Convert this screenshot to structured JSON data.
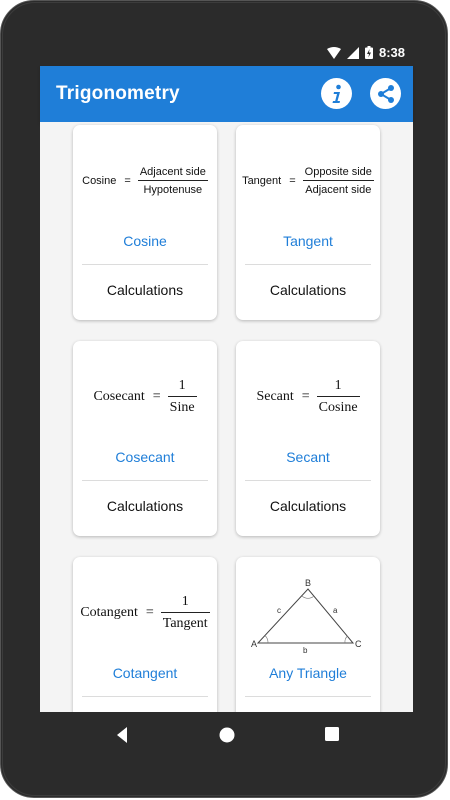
{
  "status": {
    "time": "8:38"
  },
  "appbar": {
    "title": "Trigonometry",
    "info_icon": "info-icon",
    "share_icon": "share-icon"
  },
  "cards": [
    {
      "formula_lhs": "Cosine",
      "formula_eq": "=",
      "formula_num": "Adjacent side",
      "formula_den": "Hypotenuse",
      "title": "Cosine",
      "action": "Calculations"
    },
    {
      "formula_lhs": "Tangent",
      "formula_eq": "=",
      "formula_num": "Opposite side",
      "formula_den": "Adjacent side",
      "title": "Tangent",
      "action": "Calculations"
    },
    {
      "formula_lhs": "Cosecant",
      "formula_eq": "=",
      "formula_num": "1",
      "formula_den": "Sine",
      "title": "Cosecant",
      "action": "Calculations"
    },
    {
      "formula_lhs": "Secant",
      "formula_eq": "=",
      "formula_num": "1",
      "formula_den": "Cosine",
      "title": "Secant",
      "action": "Calculations"
    },
    {
      "formula_lhs": "Cotangent",
      "formula_eq": "=",
      "formula_num": "1",
      "formula_den": "Tangent",
      "title": "Cotangent"
    },
    {
      "triangle_labels": {
        "A": "A",
        "B": "B",
        "C": "C",
        "a": "a",
        "b": "b",
        "c": "c"
      },
      "title": "Any Triangle"
    }
  ],
  "navbar": {
    "back_icon": "back-icon",
    "home_icon": "home-icon",
    "recents_icon": "recents-icon"
  },
  "colors": {
    "accent": "#1f7ed8",
    "bezel": "#2b2b2b",
    "background": "#f4f4f4"
  }
}
